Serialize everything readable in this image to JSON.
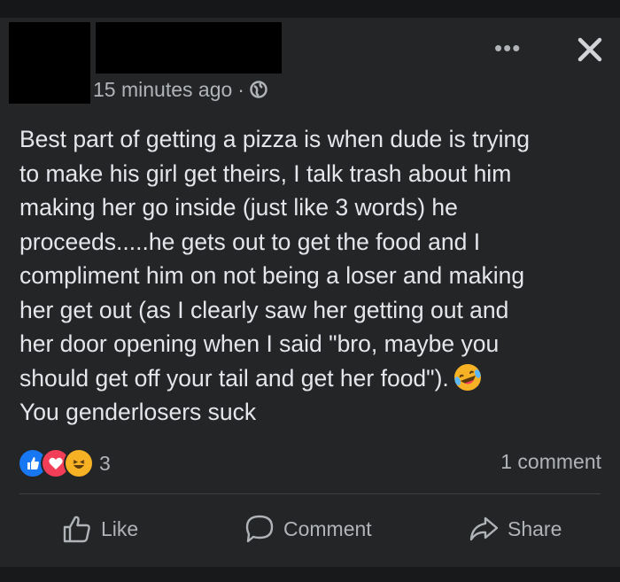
{
  "post": {
    "timestamp": "15 minutes ago",
    "separator": "·",
    "privacy_icon": "globe-icon",
    "more_label": "•••",
    "text_main": "Best part of getting a pizza is when dude is trying\nto make his girl get theirs, I talk trash about him\nmaking her go inside (just like 3 words) he\nproceeds.....he gets out to get the food and I\ncompliment him on not being a loser and making\nher get out (as I clearly saw her getting out and\nher door opening when I said \"bro, maybe you\nshould get off your tail and get her food\").",
    "text_tail": "You genderlosers suck",
    "inline_emoji": "laughing-crying-emoji-icon"
  },
  "stats": {
    "reaction_icons": [
      "like-reaction-icon",
      "love-reaction-icon",
      "haha-reaction-icon"
    ],
    "reaction_count": "3",
    "comment_count": "1 comment"
  },
  "actions": {
    "like": "Like",
    "comment": "Comment",
    "share": "Share"
  },
  "colors": {
    "background": "#18191a",
    "card": "#242526",
    "text": "#e4e6eb",
    "secondary": "#b0b3b8",
    "like_blue": "#1877f2",
    "love_red": "#f33e58",
    "haha_yellow": "#f7b125"
  }
}
